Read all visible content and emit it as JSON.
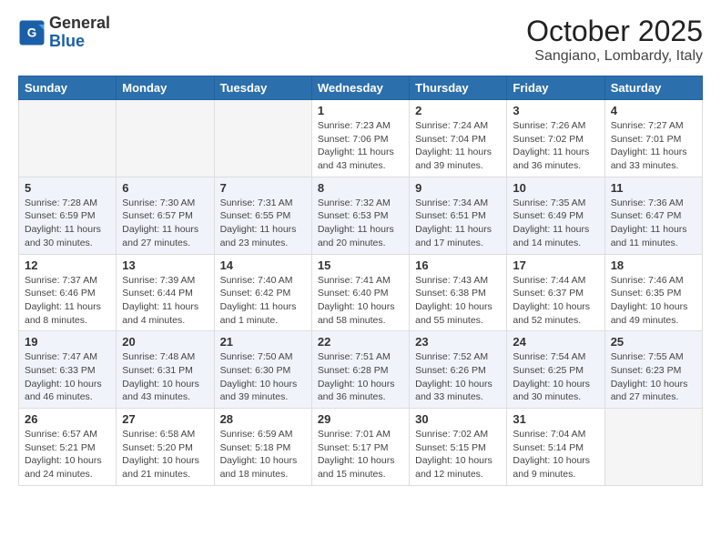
{
  "logo": {
    "general": "General",
    "blue": "Blue"
  },
  "header": {
    "month": "October 2025",
    "location": "Sangiano, Lombardy, Italy"
  },
  "weekdays": [
    "Sunday",
    "Monday",
    "Tuesday",
    "Wednesday",
    "Thursday",
    "Friday",
    "Saturday"
  ],
  "weeks": [
    [
      {
        "day": "",
        "info": ""
      },
      {
        "day": "",
        "info": ""
      },
      {
        "day": "",
        "info": ""
      },
      {
        "day": "1",
        "info": "Sunrise: 7:23 AM\nSunset: 7:06 PM\nDaylight: 11 hours\nand 43 minutes."
      },
      {
        "day": "2",
        "info": "Sunrise: 7:24 AM\nSunset: 7:04 PM\nDaylight: 11 hours\nand 39 minutes."
      },
      {
        "day": "3",
        "info": "Sunrise: 7:26 AM\nSunset: 7:02 PM\nDaylight: 11 hours\nand 36 minutes."
      },
      {
        "day": "4",
        "info": "Sunrise: 7:27 AM\nSunset: 7:01 PM\nDaylight: 11 hours\nand 33 minutes."
      }
    ],
    [
      {
        "day": "5",
        "info": "Sunrise: 7:28 AM\nSunset: 6:59 PM\nDaylight: 11 hours\nand 30 minutes."
      },
      {
        "day": "6",
        "info": "Sunrise: 7:30 AM\nSunset: 6:57 PM\nDaylight: 11 hours\nand 27 minutes."
      },
      {
        "day": "7",
        "info": "Sunrise: 7:31 AM\nSunset: 6:55 PM\nDaylight: 11 hours\nand 23 minutes."
      },
      {
        "day": "8",
        "info": "Sunrise: 7:32 AM\nSunset: 6:53 PM\nDaylight: 11 hours\nand 20 minutes."
      },
      {
        "day": "9",
        "info": "Sunrise: 7:34 AM\nSunset: 6:51 PM\nDaylight: 11 hours\nand 17 minutes."
      },
      {
        "day": "10",
        "info": "Sunrise: 7:35 AM\nSunset: 6:49 PM\nDaylight: 11 hours\nand 14 minutes."
      },
      {
        "day": "11",
        "info": "Sunrise: 7:36 AM\nSunset: 6:47 PM\nDaylight: 11 hours\nand 11 minutes."
      }
    ],
    [
      {
        "day": "12",
        "info": "Sunrise: 7:37 AM\nSunset: 6:46 PM\nDaylight: 11 hours\nand 8 minutes."
      },
      {
        "day": "13",
        "info": "Sunrise: 7:39 AM\nSunset: 6:44 PM\nDaylight: 11 hours\nand 4 minutes."
      },
      {
        "day": "14",
        "info": "Sunrise: 7:40 AM\nSunset: 6:42 PM\nDaylight: 11 hours\nand 1 minute."
      },
      {
        "day": "15",
        "info": "Sunrise: 7:41 AM\nSunset: 6:40 PM\nDaylight: 10 hours\nand 58 minutes."
      },
      {
        "day": "16",
        "info": "Sunrise: 7:43 AM\nSunset: 6:38 PM\nDaylight: 10 hours\nand 55 minutes."
      },
      {
        "day": "17",
        "info": "Sunrise: 7:44 AM\nSunset: 6:37 PM\nDaylight: 10 hours\nand 52 minutes."
      },
      {
        "day": "18",
        "info": "Sunrise: 7:46 AM\nSunset: 6:35 PM\nDaylight: 10 hours\nand 49 minutes."
      }
    ],
    [
      {
        "day": "19",
        "info": "Sunrise: 7:47 AM\nSunset: 6:33 PM\nDaylight: 10 hours\nand 46 minutes."
      },
      {
        "day": "20",
        "info": "Sunrise: 7:48 AM\nSunset: 6:31 PM\nDaylight: 10 hours\nand 43 minutes."
      },
      {
        "day": "21",
        "info": "Sunrise: 7:50 AM\nSunset: 6:30 PM\nDaylight: 10 hours\nand 39 minutes."
      },
      {
        "day": "22",
        "info": "Sunrise: 7:51 AM\nSunset: 6:28 PM\nDaylight: 10 hours\nand 36 minutes."
      },
      {
        "day": "23",
        "info": "Sunrise: 7:52 AM\nSunset: 6:26 PM\nDaylight: 10 hours\nand 33 minutes."
      },
      {
        "day": "24",
        "info": "Sunrise: 7:54 AM\nSunset: 6:25 PM\nDaylight: 10 hours\nand 30 minutes."
      },
      {
        "day": "25",
        "info": "Sunrise: 7:55 AM\nSunset: 6:23 PM\nDaylight: 10 hours\nand 27 minutes."
      }
    ],
    [
      {
        "day": "26",
        "info": "Sunrise: 6:57 AM\nSunset: 5:21 PM\nDaylight: 10 hours\nand 24 minutes."
      },
      {
        "day": "27",
        "info": "Sunrise: 6:58 AM\nSunset: 5:20 PM\nDaylight: 10 hours\nand 21 minutes."
      },
      {
        "day": "28",
        "info": "Sunrise: 6:59 AM\nSunset: 5:18 PM\nDaylight: 10 hours\nand 18 minutes."
      },
      {
        "day": "29",
        "info": "Sunrise: 7:01 AM\nSunset: 5:17 PM\nDaylight: 10 hours\nand 15 minutes."
      },
      {
        "day": "30",
        "info": "Sunrise: 7:02 AM\nSunset: 5:15 PM\nDaylight: 10 hours\nand 12 minutes."
      },
      {
        "day": "31",
        "info": "Sunrise: 7:04 AM\nSunset: 5:14 PM\nDaylight: 10 hours\nand 9 minutes."
      },
      {
        "day": "",
        "info": ""
      }
    ]
  ]
}
